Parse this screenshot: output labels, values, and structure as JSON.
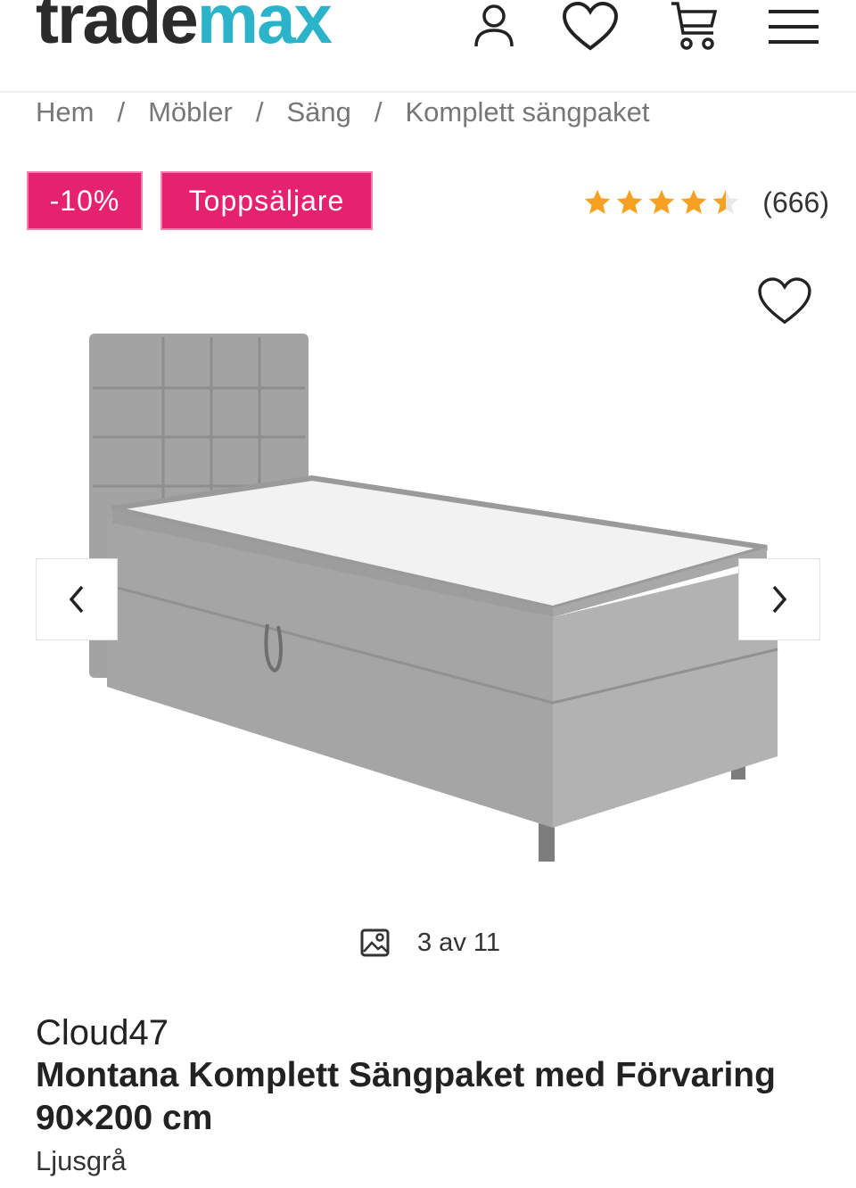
{
  "header": {
    "logo_part1": "trade",
    "logo_part2": "max",
    "icons": [
      "user-icon",
      "heart-icon",
      "cart-icon",
      "menu-icon"
    ],
    "logo_colors": {
      "dark": "#2b2b2b",
      "accent": "#2bb3c9"
    }
  },
  "breadcrumb": {
    "items": [
      "Hem",
      "Möbler",
      "Säng",
      "Komplett sängpaket"
    ],
    "separator": "/"
  },
  "badges": {
    "discount": "-10%",
    "bestseller": "Toppsäljare",
    "color": "#e4226f"
  },
  "rating": {
    "score": 4.5,
    "max": 5,
    "count_label": "(666)",
    "star_color": "#f7a123"
  },
  "gallery": {
    "counter": "3 av 11",
    "current": 3,
    "total": 11
  },
  "product": {
    "brand": "Cloud47",
    "title": "Montana Komplett Sängpaket med Förvaring 90×200 cm",
    "variant": "Ljusgrå"
  }
}
